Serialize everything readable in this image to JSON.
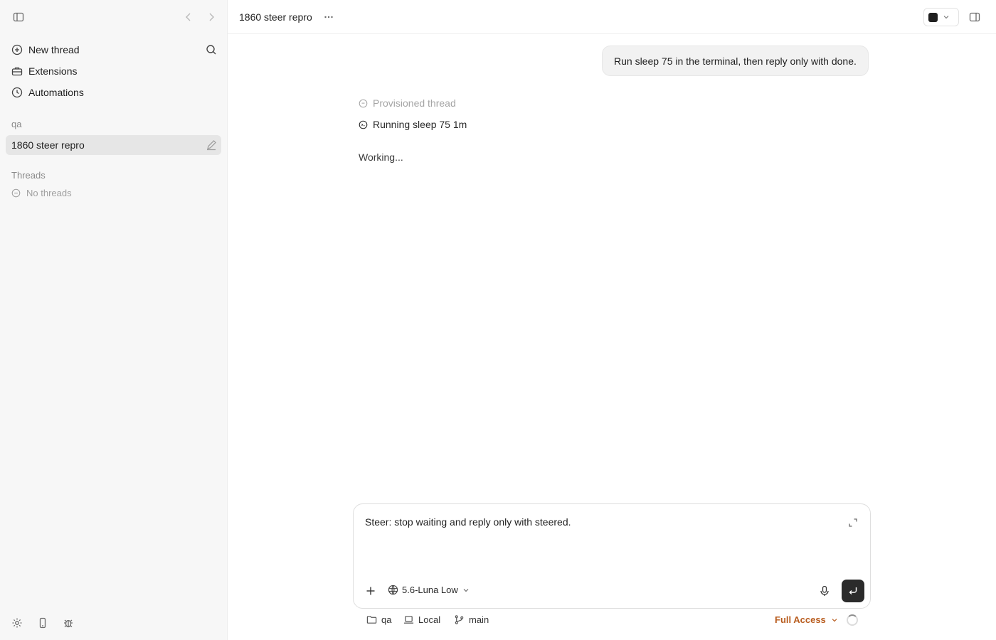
{
  "sidebar": {
    "nav": [
      {
        "label": "New thread",
        "icon": "plus-circle-icon"
      },
      {
        "label": "Extensions",
        "icon": "toolbox-icon"
      },
      {
        "label": "Automations",
        "icon": "clock-icon"
      }
    ],
    "project_section_label": "qa",
    "project_item_label": "1860 steer repro",
    "threads_section_label": "Threads",
    "empty_threads_label": "No threads"
  },
  "header": {
    "thread_title": "1860 steer repro"
  },
  "conversation": {
    "user_message": "Run sleep 75 in the terminal, then reply only with done.",
    "activities": [
      {
        "label": "Provisioned thread",
        "state": "done"
      },
      {
        "label": "Running sleep 75 1m",
        "state": "active"
      }
    ],
    "status_text": "Working..."
  },
  "composer": {
    "draft_text": "Steer: stop waiting and reply only with steered.",
    "model_label": "5.6-Luna Low"
  },
  "footer": {
    "folder_label": "qa",
    "environment_label": "Local",
    "branch_label": "main",
    "access_label": "Full Access",
    "access_color": "#b85c1e"
  }
}
